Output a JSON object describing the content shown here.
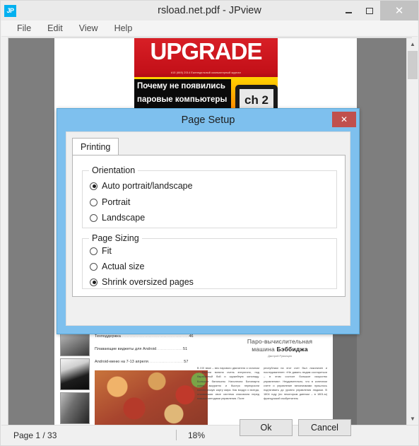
{
  "window": {
    "title": "rsload.net.pdf - JPview",
    "app_icon_label": "JP",
    "controls": {
      "minimize": "minimize-icon",
      "maximize": "maximize-icon",
      "close": "✕"
    }
  },
  "menubar": {
    "items": [
      {
        "label": "File"
      },
      {
        "label": "Edit"
      },
      {
        "label": "View"
      },
      {
        "label": "Help"
      }
    ]
  },
  "statusbar": {
    "page_label": "Page 1 / 33",
    "zoom_label": "18%"
  },
  "scrollbar": {
    "up_arrow": "▲",
    "down_arrow": "▼"
  },
  "document": {
    "cover": {
      "logo_up": "UP",
      "logo_grade": "GRADE",
      "subtitle": "#15 (669) 2014 Еженедельный компьютерный журнал",
      "headline_line1": "Почему не появились",
      "headline_line2": "паровые компьютеры",
      "device_text": "ch 2"
    },
    "toc": [
      {
        "title": "Техподдержка",
        "dots": "..............................................",
        "page": "46"
      },
      {
        "title": "Плавающие виджеты для Android",
        "dots": "..................",
        "page": "51"
      },
      {
        "title": "Android-меню на 7-13 апреля",
        "dots": "........................",
        "page": "57"
      }
    ],
    "article": {
      "title_line1": "Паро-вычислительная",
      "title_line2_plain": "машина ",
      "title_line2_bold": "Бэббиджа",
      "author": "Дмитрий Румянцев",
      "column1": "В XIX веке – век парового двигателя и галопом – Европа вопила очень энергично, под барабанный бой и оружейную канонаду. Большие батальоны Наполеона Бонапарта очень аккуратно и быстро перекроили политическую карту мира. Как воздух и всегда, отживавшая свое система спасовала перед новыми методами управления. Поле",
      "column2": "республики на этот счет был лаконичен и последователен: «Не давать людям состариться – в этом состоит большое искусство управления». Неудивительно, что в конечном счете и управление механизмами пришлось подтягивать до уровня управления людьми. В 1804 году (по некоторым данным – в 1801-м) французский изобретатель"
    }
  },
  "dialog": {
    "title": "Page Setup",
    "close_glyph": "✕",
    "tabs": [
      {
        "label": "Printing",
        "active": true
      }
    ],
    "groups": [
      {
        "label": "Orientation",
        "options": [
          {
            "label": "Auto portrait/landscape",
            "checked": true
          },
          {
            "label": "Portrait",
            "checked": false
          },
          {
            "label": "Landscape",
            "checked": false
          }
        ]
      },
      {
        "label": "Page Sizing",
        "options": [
          {
            "label": "Fit",
            "checked": false
          },
          {
            "label": "Actual size",
            "checked": false
          },
          {
            "label": "Shrink oversized pages",
            "checked": true
          }
        ]
      }
    ],
    "buttons": {
      "ok": "Ok",
      "cancel": "Cancel"
    }
  },
  "colors": {
    "dialog_title_bar": "#7ec0ee",
    "dialog_close": "#c0504d",
    "viewer_bg": "#7e7e7e",
    "app_icon": "#00b0f0",
    "cover_red": "#c31018"
  }
}
